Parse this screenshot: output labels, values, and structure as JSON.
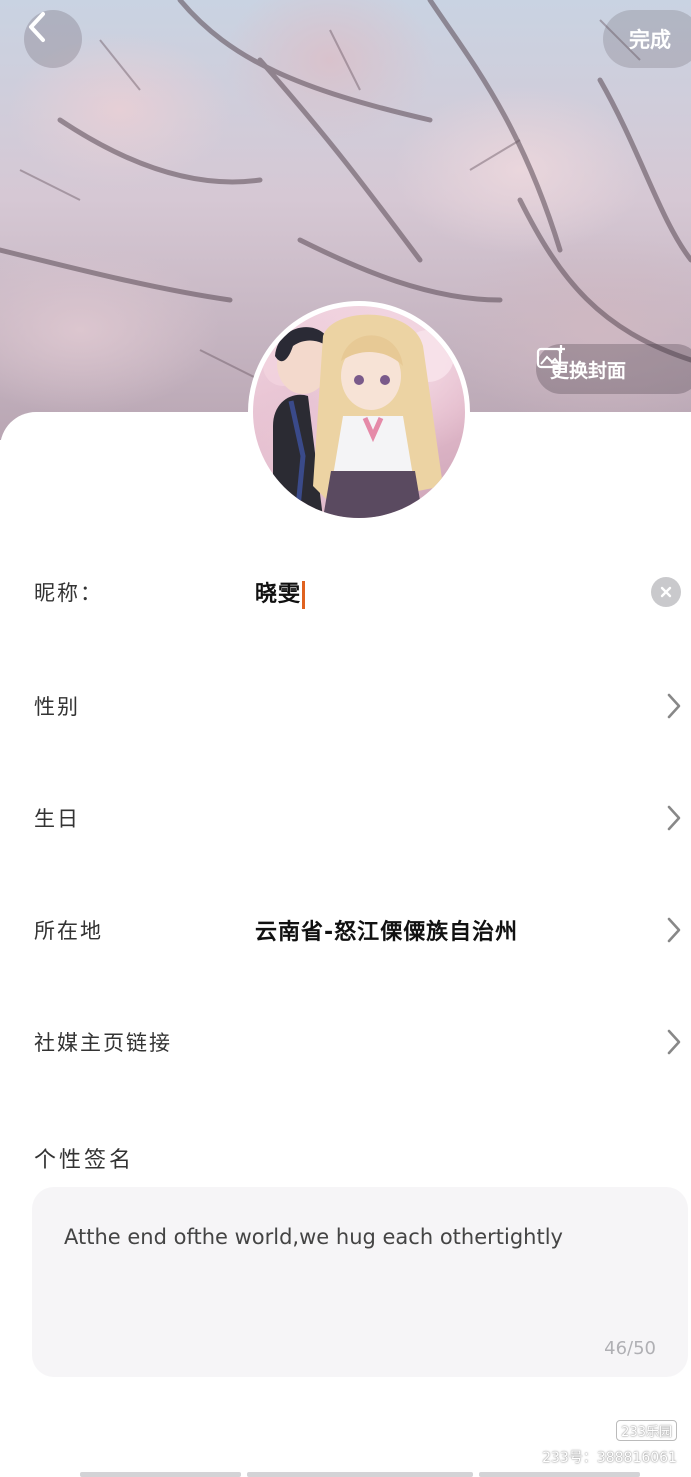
{
  "header": {
    "back_icon": "chevron-left-icon",
    "done_label": "完成",
    "change_cover_label": "更换封面",
    "change_cover_icon": "image-plus-icon"
  },
  "profile": {
    "avatar_icon": "anime-couple-avatar"
  },
  "fields": {
    "nickname": {
      "label": "昵称：",
      "value": "晓雯"
    },
    "gender": {
      "label": "性别",
      "value": ""
    },
    "birthday": {
      "label": "生日",
      "value": ""
    },
    "location": {
      "label": "所在地",
      "value": "云南省-怒江傈僳族自治州"
    },
    "social_link": {
      "label": "社媒主页链接",
      "value": ""
    }
  },
  "signature": {
    "title": "个性签名",
    "text": "Atthe end ofthe world,we hug each othertightly",
    "count": "46/50"
  },
  "watermark": {
    "logo": "233乐园",
    "id_text": "233号：388816061"
  },
  "colors": {
    "caret": "#e0621f",
    "clear_button": "#c9c9cc"
  }
}
